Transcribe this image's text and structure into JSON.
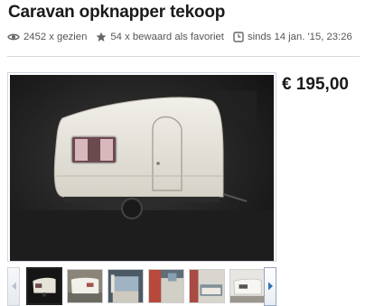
{
  "listing": {
    "title": "Caravan opknapper tekoop",
    "views": "2452 x gezien",
    "favorites": "54 x bewaard als favoriet",
    "since": "sinds 14 jan. '15, 23:26",
    "price": "€ 195,00"
  },
  "icons": {
    "views": "eye-icon",
    "favorites": "star-icon",
    "since": "clock-icon",
    "prev": "chevron-left-icon",
    "next": "chevron-right-icon"
  },
  "gallery": {
    "active_index": 0,
    "thumbnails": [
      "caravan-front-view",
      "caravan-side-view",
      "caravan-interior-window",
      "caravan-interior-red",
      "caravan-interior-white",
      "caravan-exterior-rear"
    ]
  },
  "colors": {
    "accent_blue": "#2f6fb6",
    "text": "#1a1a1a",
    "meta_text": "#555555"
  }
}
